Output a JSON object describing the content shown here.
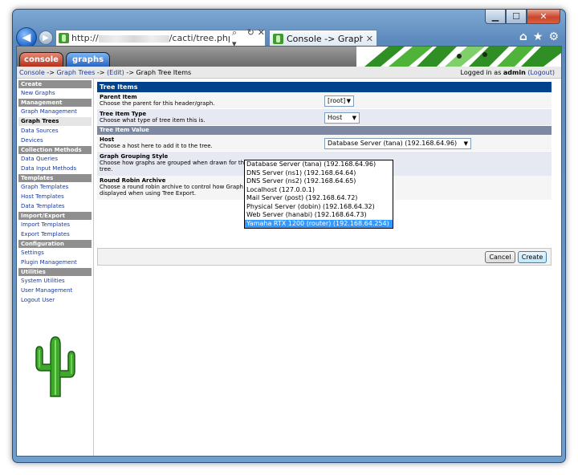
{
  "browser": {
    "url_prefix": "http://",
    "url_suffix": "/cacti/tree.php?actior",
    "tab_title": "Console -> Graph Trees ...",
    "tab_close": "✕",
    "addr_icons": [
      "⌕ ▾",
      "↻",
      "✕"
    ],
    "tools": [
      "⌂",
      "★",
      "⚙"
    ],
    "window_buttons": [
      "▁",
      "☐",
      "✕"
    ]
  },
  "header": {
    "tab_console": "console",
    "tab_graphs": "graphs"
  },
  "breadcrumb": {
    "console": "Console",
    "sep1": " -> ",
    "graph_trees": "Graph Trees",
    "sep2": " -> ",
    "edit": "(Edit)",
    "sep3": " -> ",
    "current": "Graph Tree Items"
  },
  "login": {
    "prefix": "Logged in as ",
    "user": "admin",
    "logout": "(Logout)"
  },
  "sidebar": {
    "sections": [
      {
        "head": "Create",
        "items": [
          "New Graphs"
        ]
      },
      {
        "head": "Management",
        "items": [
          "Graph Management",
          "Graph Trees",
          "Data Sources",
          "Devices"
        ]
      },
      {
        "head": "Collection Methods",
        "items": [
          "Data Queries",
          "Data Input Methods"
        ]
      },
      {
        "head": "Templates",
        "items": [
          "Graph Templates",
          "Host Templates",
          "Data Templates"
        ]
      },
      {
        "head": "Import/Export",
        "items": [
          "Import Templates",
          "Export Templates"
        ]
      },
      {
        "head": "Configuration",
        "items": [
          "Settings",
          "Plugin Management"
        ]
      },
      {
        "head": "Utilities",
        "items": [
          "System Utilities",
          "User Management",
          "Logout User"
        ]
      }
    ],
    "active_item": "Graph Trees"
  },
  "form": {
    "title": "Tree Items",
    "parent_label": "Parent Item",
    "parent_desc": "Choose the parent for this header/graph.",
    "parent_value": "[root]",
    "type_label": "Tree Item Type",
    "type_desc": "Choose what type of tree item this is.",
    "type_value": "Host",
    "value_head": "Tree Item Value",
    "host_label": "Host",
    "host_desc": "Choose a host here to add it to the tree.",
    "host_value": "Database Server (tana) (192.168.64.96)",
    "grouping_label": "Graph Grouping Style",
    "grouping_desc": "Choose how graphs are grouped when drawn for this particular host on the tree.",
    "rra_label": "Round Robin Archive",
    "rra_desc": "Choose a round robin archive to control how Graph Thumbnails are displayed when using Tree Export.",
    "host_options": [
      "Database Server (tana) (192.168.64.96)",
      "DNS Server (ns1) (192.168.64.64)",
      "DNS Server (ns2) (192.168.64.65)",
      "Localhost (127.0.0.1)",
      "Mail Server (post) (192.168.64.72)",
      "Physical Server (dobin) (192.168.64.32)",
      "Web Server (hanabi) (192.168.64.73)",
      "Yamaha RTX 1200 (router) (192.168.64.254)"
    ],
    "highlighted_option": "Yamaha RTX 1200 (router) (192.168.64.254)",
    "cancel_label": "Cancel",
    "create_label": "Create"
  },
  "colors": {
    "panel_title_bg": "#00438c",
    "link": "#1a3a9c",
    "selected_option": "#3399ff"
  }
}
